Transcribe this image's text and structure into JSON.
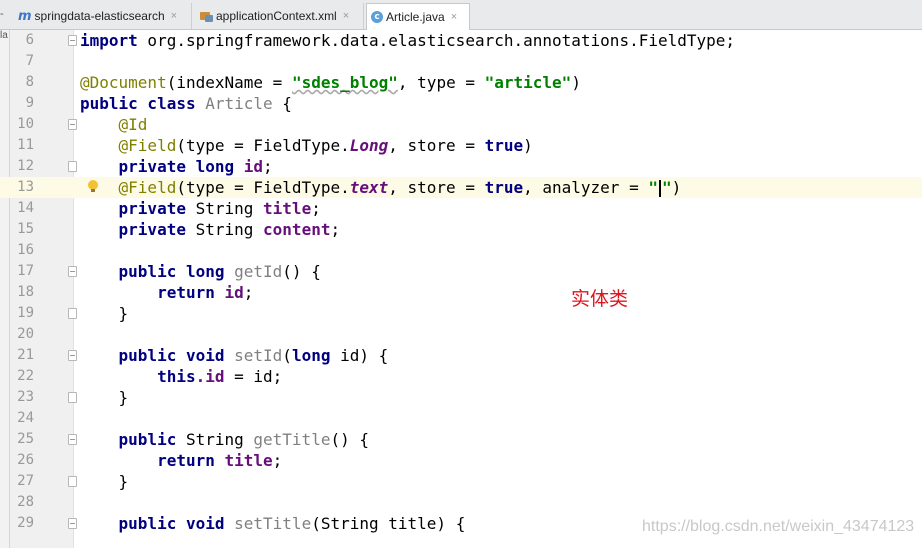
{
  "tabs": [
    {
      "label": "springdata-elasticsearch",
      "icon": "maven-module-icon",
      "close": "×"
    },
    {
      "label": "applicationContext.xml",
      "icon": "xml-file-icon",
      "close": "×"
    },
    {
      "label": "Article.java",
      "icon": "java-class-icon",
      "close": "×"
    }
  ],
  "left_stub": "la",
  "editor": {
    "current_line": 13,
    "lines": [
      {
        "n": "6"
      },
      {
        "n": "7"
      },
      {
        "n": "8"
      },
      {
        "n": "9"
      },
      {
        "n": "10"
      },
      {
        "n": "11"
      },
      {
        "n": "12"
      },
      {
        "n": "13"
      },
      {
        "n": "14"
      },
      {
        "n": "15"
      },
      {
        "n": "16"
      },
      {
        "n": "17"
      },
      {
        "n": "18"
      },
      {
        "n": "19"
      },
      {
        "n": "20"
      },
      {
        "n": "21"
      },
      {
        "n": "22"
      },
      {
        "n": "23"
      },
      {
        "n": "24"
      },
      {
        "n": "25"
      },
      {
        "n": "26"
      },
      {
        "n": "27"
      },
      {
        "n": "28"
      },
      {
        "n": "29"
      }
    ],
    "tokens": {
      "import": "import",
      "import_path": " org.springframework.data.elasticsearch.annotations.FieldType;",
      "document_ann": "@Document",
      "document_args_1": "(indexName = ",
      "index_name": "\"sdes_blog\"",
      "document_args_2": ", type = ",
      "type_value": "\"article\"",
      "close_paren": ")",
      "public_class": "public class",
      "class_name": " Article ",
      "brace_open": "{",
      "id_ann": "@Id",
      "field_ann": "@Field",
      "field1_a": "(type = FieldType.",
      "field1_type": "Long",
      "field1_b": ", store = ",
      "true": "true",
      "private_long": "private long",
      "id_field": " id",
      "semi": ";",
      "field2_type": "text",
      "field2_c": ", analyzer = ",
      "quote": "\"",
      "private_string": "private",
      "string_type": " String ",
      "title_field": "title",
      "content_field": "content",
      "public_long": "public long",
      "get_id": " getId",
      "empty_parens": "() ",
      "return": "return",
      "brace_close": "}",
      "public_void": "public void",
      "set_id": " setId",
      "set_id_args_a": "(",
      "long_kw": "long",
      "set_id_args_b": " id) ",
      "this": "this",
      "dot_id": ".id",
      "assign_id": " = id;",
      "public": "public",
      "get_title": "getTitle",
      "set_title": " setTitle",
      "set_title_args": "(String title) "
    }
  },
  "annotation_note": "实体类",
  "watermark": "https://blog.csdn.net/weixin_43474123"
}
